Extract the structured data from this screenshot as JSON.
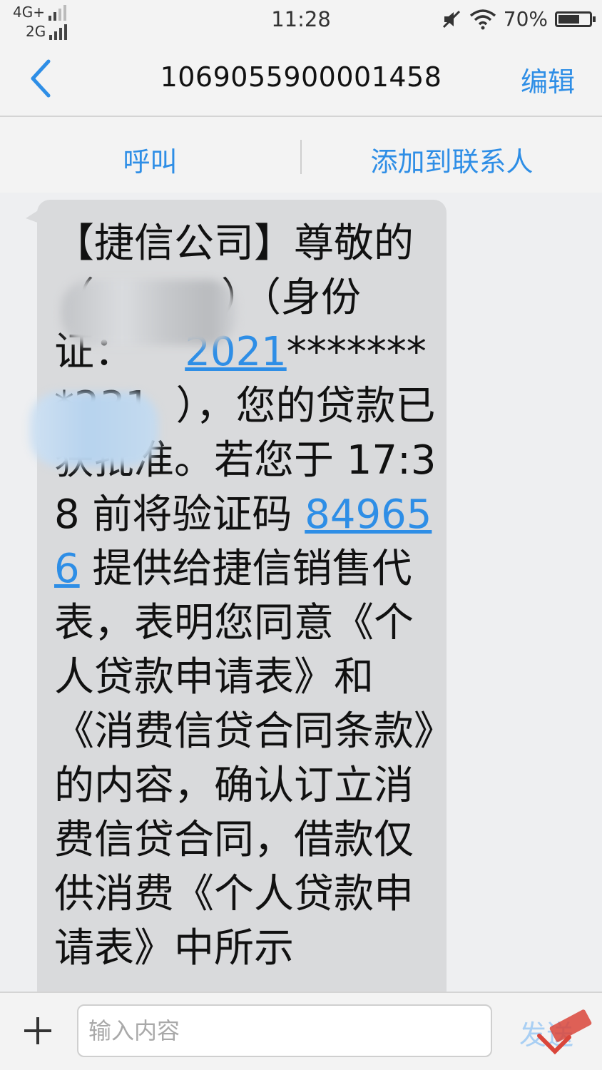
{
  "status_bar": {
    "network_top": "4G+",
    "network_bottom": "2G",
    "time": "11:28",
    "battery": "70%",
    "battery_level": 0.7,
    "icons": [
      "mute-icon",
      "wifi-icon",
      "battery-icon"
    ]
  },
  "header": {
    "title": "1069055900001458",
    "edit_label": "编辑"
  },
  "actions": {
    "call_label": "呼叫",
    "add_contact_label": "添加到联系人"
  },
  "message": {
    "part1": "【捷信公司】尊敬的（          ）（身份证：    ",
    "id_link": "2021",
    "part2": "********231  ），您的贷款已获批准。若您于 17:38 前将验证码 ",
    "code_link": "849656",
    "part3": " 提供给捷信销售代表，表明您同意《个人贷款申请表》和《消费信贷合同条款》的内容，确认订立消费信贷合同，借款仅供消费《个人贷款申请表》中所示"
  },
  "composer": {
    "placeholder": "输入内容",
    "send_label": "发送"
  },
  "colors": {
    "accent": "#2e8ee6",
    "bubble": "#d9dadc",
    "background": "#eeeff1"
  }
}
